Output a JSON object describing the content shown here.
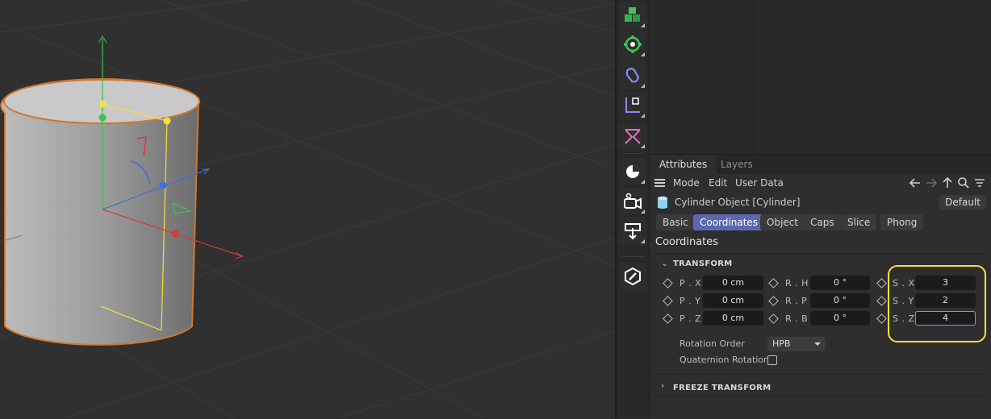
{
  "attributes": {
    "tabs": [
      {
        "label": "Attributes"
      },
      {
        "label": "Layers"
      }
    ],
    "menu": [
      {
        "label": "Mode"
      },
      {
        "label": "Edit"
      },
      {
        "label": "User Data"
      }
    ],
    "object_title": "Cylinder Object [Cylinder]",
    "default_label": "Default",
    "property_tabs": [
      {
        "label": "Basic"
      },
      {
        "label": "Coordinates"
      },
      {
        "label": "Object"
      },
      {
        "label": "Caps"
      },
      {
        "label": "Slice"
      },
      {
        "label": "Phong"
      }
    ],
    "active_tab": "Coordinates",
    "section_title": "Coordinates",
    "transform": {
      "header": "TRANSFORM",
      "position": [
        {
          "label": "P . X",
          "value": "0 cm"
        },
        {
          "label": "P . Y",
          "value": "0 cm"
        },
        {
          "label": "P . Z",
          "value": "0 cm"
        }
      ],
      "rotation": [
        {
          "label": "R . H",
          "value": "0 °"
        },
        {
          "label": "R . P",
          "value": "0 °"
        },
        {
          "label": "R . B",
          "value": "0 °"
        }
      ],
      "scale": [
        {
          "label": "S . X",
          "value": "3"
        },
        {
          "label": "S . Y",
          "value": "2"
        },
        {
          "label": "S . Z",
          "value": "4"
        }
      ],
      "rotation_order_label": "Rotation Order",
      "rotation_order_value": "HPB",
      "quaternion_label": "Quaternion Rotation"
    },
    "freeze_header": "FREEZE TRANSFORM"
  },
  "toolbar_icons": [
    "cube-primitive-icon",
    "generator-icon",
    "spline-icon",
    "deformer-icon",
    "field-icon",
    "light-icon",
    "camera-icon",
    "floor-icon",
    "edit-tag-icon"
  ],
  "colors": {
    "accent": "#5b67b2",
    "highlight": "#f2e33b",
    "selection": "#d2762a"
  }
}
